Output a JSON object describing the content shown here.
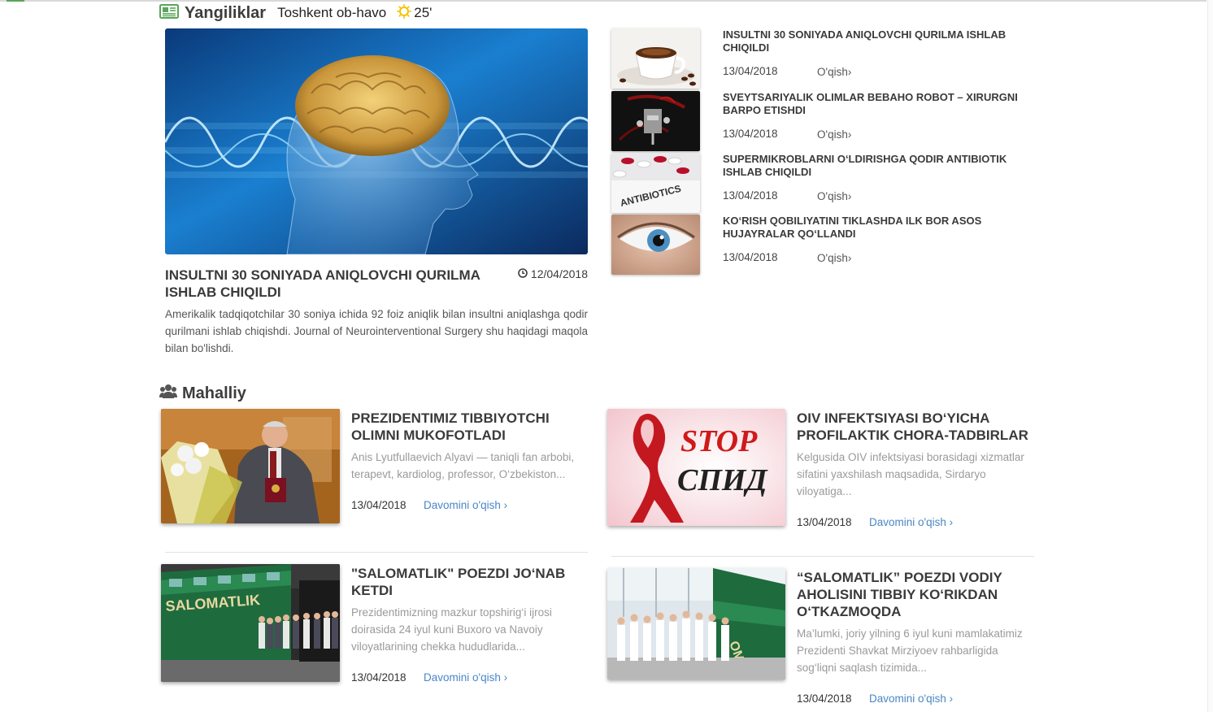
{
  "news_section": {
    "title": "Yangiliklar",
    "weather_label": "Toshkent ob-havo",
    "temperature": "25'",
    "icon": "newspaper-icon",
    "weather_icon": "sun-icon"
  },
  "featured": {
    "title": "INSULTNI 30 SONIYADA ANIQLOVCHI QURILMA ISHLAB CHIQILDI",
    "date": "12/04/2018",
    "excerpt": "Amerikalik tadqiqotchilar 30 soniya ichida 92 foiz aniqlik bilan insultni aniqlashga qodir qurilmani ishlab chiqishdi. Journal of Neurointerventional Surgery shu haqidagi maqola bilan bo'lishdi."
  },
  "side_news": [
    {
      "title": "INSULTNI 30 SONIYADA ANIQLOVCHI QURILMA ISHLAB CHIQILDI",
      "date": "13/04/2018",
      "read": "O'qish"
    },
    {
      "title": "SVEYTSARIYALIK OLIMLAR BEBAHO ROBOT – XIRURGNI BARPO ETISHDI",
      "date": "13/04/2018",
      "read": "O'qish"
    },
    {
      "title": "SUPERMIKROBLARNI O‘LDIRISHGA QODIR ANTIBIOTIK ISHLAB ChIQILDI",
      "date": "13/04/2018",
      "read": "O'qish",
      "thumb_text": "ANTIBIOTICS"
    },
    {
      "title": "KO‘RISH QOBILIYATINI TIKLASHDA ILK BOR ASOS HUJAYRALAR QO‘LLANDI",
      "date": "13/04/2018",
      "read": "O'qish"
    }
  ],
  "local_section": {
    "title": "Mahalliy",
    "icon": "users-icon"
  },
  "local_news": [
    {
      "title": "PREZIDENTIMIZ TIBBIYOTCHI OLIMNI MUKOFOTLADI",
      "excerpt": "Anis Lyutfullaevich Alyavi — taniqli fan arbobi, terapevt, kardiolog, professor, O‘zbekiston...",
      "date": "13/04/2018",
      "more": "Davomini o'qish"
    },
    {
      "title": "OIV INFEKTSIYASI BO‘YICHA PROFILAKTIK CHORA-TADBIRLAR",
      "excerpt": "Kelgusida OIV infektsiyasi borasidagi xizmatlar sifatini yaxshilash maqsadida, Sirdaryo viloyatiga...",
      "date": "13/04/2018",
      "more": "Davomini o'qish",
      "img_text_1": "STOP",
      "img_text_2": "СПИД"
    },
    {
      "title": "\"SALOMATLIK\" POEZDI JO‘NAB KETDI",
      "excerpt": "Prezidentimizning mazkur topshirig‘i ijrosi doirasida 24 iyul kuni Buxoro va Navoiy viloyatlarining chekka hududlarida...",
      "date": "13/04/2018",
      "more": "Davomini o'qish",
      "img_text": "SALOMATLIK"
    },
    {
      "title": "“SALOMATLIK” POEZDI VODIY AHOLISINI TIBBIY KO‘RIKDAN O‘TKAZMOQDA",
      "excerpt": "Ma’lumki, joriy yilning 6 iyul kuni mamlakatimiz Prezidenti Shavkat Mirziyoev rahbarligida sog‘liqni saqlash tizimida...",
      "date": "13/04/2018",
      "more": "Davomini o'qish",
      "img_text": "OMATLI"
    }
  ],
  "colors": {
    "accent_green": "#5aa55a",
    "sun_yellow": "#f2c200",
    "link_blue": "#4a86c6",
    "heading": "#3a3a3a"
  }
}
